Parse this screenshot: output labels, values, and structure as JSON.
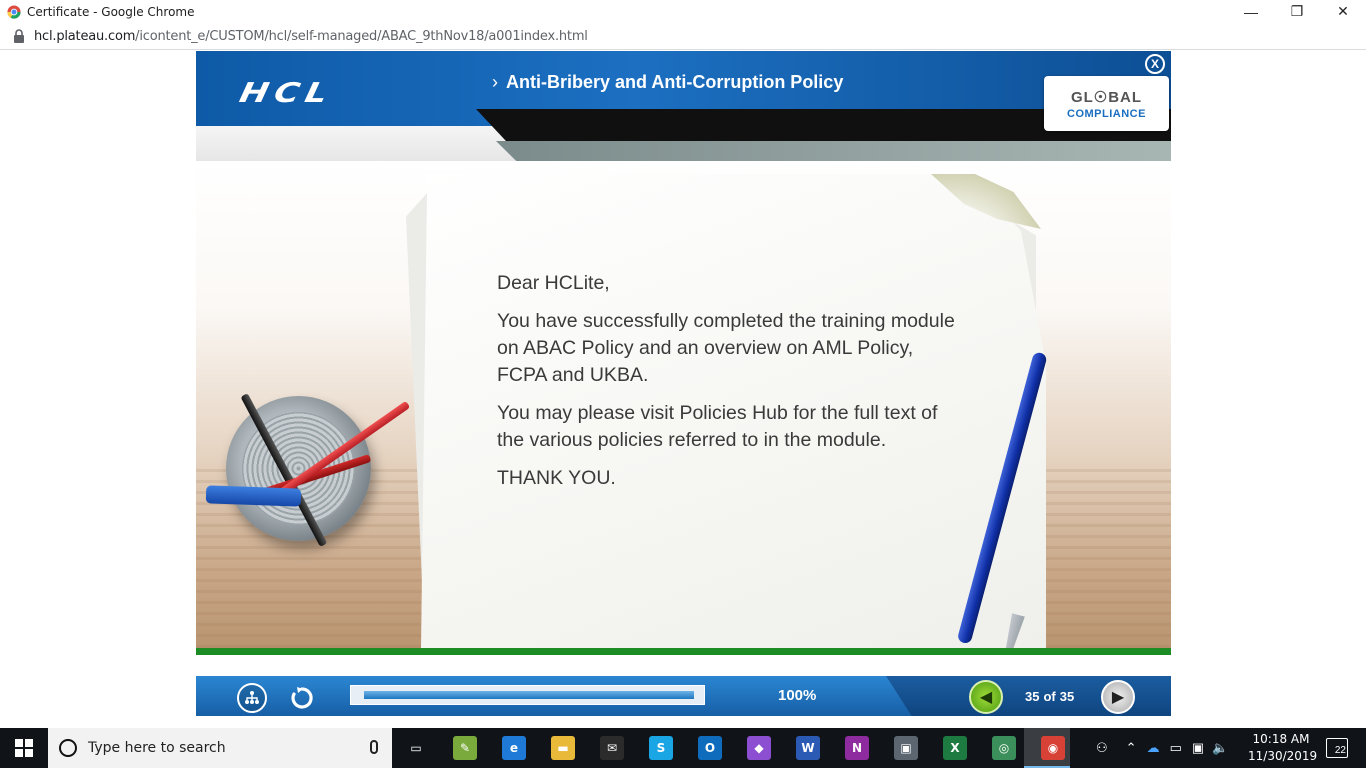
{
  "window": {
    "title": "Certificate - Google Chrome",
    "controls": {
      "minimize": "—",
      "restore": "❐",
      "close": "✕"
    }
  },
  "address": {
    "host": "hcl.plateau.com",
    "path": "/icontent_e/CUSTOM/hcl/self-managed/ABAC_9thNov18/a001index.html"
  },
  "course": {
    "logo": "HCL",
    "title": "Anti-Bribery and Anti-Corruption Policy",
    "badge_line1": "GL☉BAL",
    "badge_line2": "COMPLIANCE",
    "close_label": "X"
  },
  "letter": {
    "greeting": "Dear HCLite,",
    "para1": "You have successfully completed the training module on ABAC Policy and an overview on AML Policy, FCPA and UKBA.",
    "para2": "You may please visit Policies Hub for the full text of the various policies referred to in the module.",
    "closing": "THANK YOU."
  },
  "player": {
    "progress_percent_label": "100%",
    "progress_fraction": 1.0,
    "current_page": "35",
    "of_label": "of",
    "total_pages": "35"
  },
  "taskbar": {
    "search_placeholder": "Type here to search",
    "time": "10:18 AM",
    "date": "11/30/2019",
    "notification_count": "22",
    "apps": [
      {
        "name": "task-view",
        "color": "#101418",
        "glyph": "▭"
      },
      {
        "name": "sticky-notes",
        "color": "#7aa93c",
        "glyph": "✎"
      },
      {
        "name": "edge",
        "color": "#1e7ad6",
        "glyph": "e"
      },
      {
        "name": "file-explorer",
        "color": "#e9b93a",
        "glyph": "▬"
      },
      {
        "name": "mail",
        "color": "#2b2b2b",
        "glyph": "✉"
      },
      {
        "name": "skype",
        "color": "#1aa5e5",
        "glyph": "S"
      },
      {
        "name": "outlook",
        "color": "#0f6cbd",
        "glyph": "O"
      },
      {
        "name": "visual-studio",
        "color": "#8c4fd1",
        "glyph": "◆"
      },
      {
        "name": "word",
        "color": "#2b5ab5",
        "glyph": "W"
      },
      {
        "name": "onenote",
        "color": "#8e2b9e",
        "glyph": "N"
      },
      {
        "name": "remote-desktop",
        "color": "#5b6670",
        "glyph": "▣"
      },
      {
        "name": "excel",
        "color": "#1d7a41",
        "glyph": "X"
      },
      {
        "name": "network-app",
        "color": "#3a8f5a",
        "glyph": "◎"
      },
      {
        "name": "chrome",
        "color": "#d84236",
        "glyph": "◉"
      }
    ]
  }
}
